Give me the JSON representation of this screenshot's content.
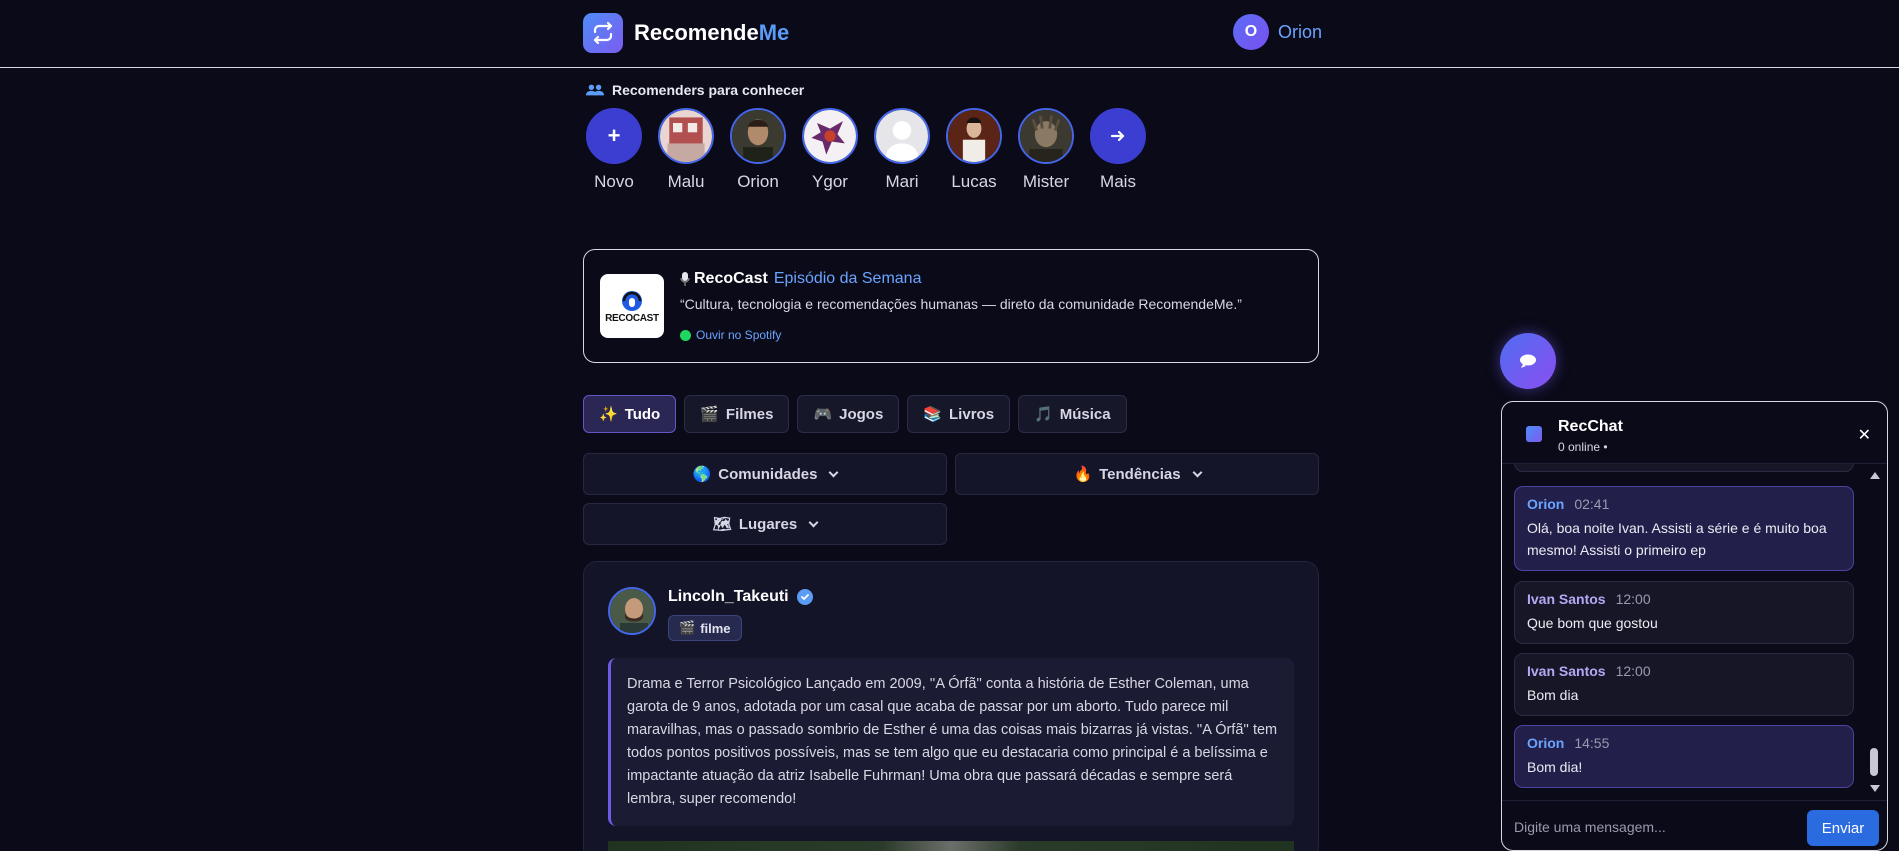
{
  "header": {
    "brand_main": "Recomende",
    "brand_accent": "Me",
    "user_initial": "O",
    "user_name": "Orion"
  },
  "recommenders": {
    "title": "Recomenders para conhecer",
    "new_label": "Novo",
    "more_label": "Mais",
    "people": [
      "Malu",
      "Orion",
      "Ygor",
      "Mari",
      "Lucas",
      "Mister"
    ]
  },
  "podcast": {
    "logo_text": "RECOCAST",
    "name": "RecoCast",
    "episode": "Episódio da Semana",
    "description": "“Cultura, tecnologia e recomendações humanas — direto da comunidade RecomendeMe.”",
    "link": "Ouvir no Spotify"
  },
  "tabs": [
    {
      "icon": "✨",
      "label": "Tudo"
    },
    {
      "icon": "🎬",
      "label": "Filmes"
    },
    {
      "icon": "🎮",
      "label": "Jogos"
    },
    {
      "icon": "📚",
      "label": "Livros"
    },
    {
      "icon": "🎵",
      "label": "Música"
    }
  ],
  "dropdowns": {
    "comunidades": {
      "icon": "🌎",
      "label": "Comunidades"
    },
    "tendencias": {
      "icon": "🔥",
      "label": "Tendências"
    },
    "lugares": {
      "icon": "🗺",
      "label": "Lugares"
    }
  },
  "post": {
    "author": "Lincoln_Takeuti",
    "tag_icon": "🎬",
    "tag": "filme",
    "text": "Drama e Terror Psicológico Lançado em 2009, ''A Órfã'' conta a história de Esther Coleman, uma garota de 9 anos, adotada por um casal que acaba de passar por um aborto. Tudo parece mil maravilhas, mas o passado sombrio de Esther é uma das coisas mais bizarras já vistas. ''A Órfã'' tem todos pontos positivos possíveis, mas se tem algo que eu destacaria como principal é a belíssima e impactante atuação da atriz Isabelle Fuhrman! Uma obra que passará décadas e sempre será lembra, super recomendo!"
  },
  "chat": {
    "title": "RecChat",
    "subtitle": "0 online •",
    "close": "✕",
    "messages": [
      {
        "author": "Orion",
        "time": "02:41",
        "text": "Olá, boa noite Ivan. Assisti a série e é muito boa mesmo! Assisti o primeiro ep"
      },
      {
        "author": "Ivan Santos",
        "time": "12:00",
        "text": "Que bom que gostou"
      },
      {
        "author": "Ivan Santos",
        "time": "12:00",
        "text": "Bom dia"
      },
      {
        "author": "Orion",
        "time": "14:55",
        "text": "Bom dia!"
      }
    ],
    "input_placeholder": "Digite uma mensagem...",
    "send_label": "Enviar"
  },
  "colors": {
    "background": "#0b0a18",
    "accent_blue": "#5b9cf6",
    "accent_purple": "#6b5ce6",
    "send_button": "#2b6be0"
  }
}
